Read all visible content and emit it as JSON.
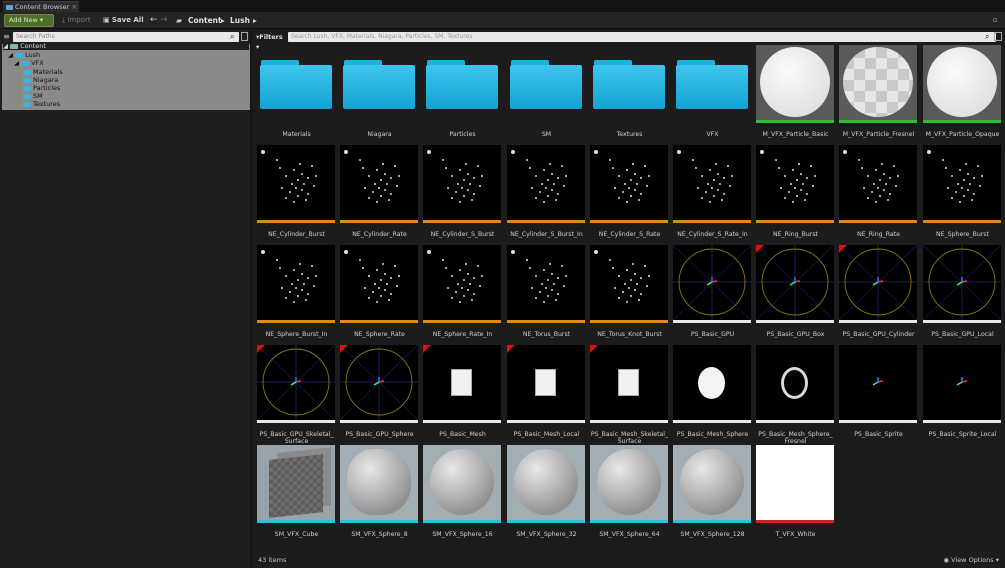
{
  "window": {
    "tab_title": "Content Browser",
    "tab_close": "×"
  },
  "toolbar": {
    "add_new": "Add New",
    "import": "Import",
    "save_all": "Save All",
    "crumbs": [
      "Content",
      "Lush"
    ]
  },
  "left": {
    "search_placeholder": "Search Paths",
    "tree": [
      "Content",
      "Lush",
      "VFX",
      "Materials",
      "Niagara",
      "Particles",
      "SM",
      "Textures"
    ]
  },
  "content": {
    "filters": "Filters",
    "search_placeholder": "Search Lush, VFX, Materials, Niagara, Particles, SM, Textures",
    "item_count": "43 items",
    "view_options": "View Options",
    "assets": [
      {
        "label": "Materials",
        "kind": "folder"
      },
      {
        "label": "Niagara",
        "kind": "folder"
      },
      {
        "label": "Particles",
        "kind": "folder"
      },
      {
        "label": "SM",
        "kind": "folder"
      },
      {
        "label": "Textures",
        "kind": "folder"
      },
      {
        "label": "VFX",
        "kind": "folder"
      },
      {
        "label": "M_VFX_Particle_Basic",
        "kind": "material"
      },
      {
        "label": "M_VFX_Particle_Fresnel",
        "kind": "material"
      },
      {
        "label": "M_VFX_Particle_Opaque",
        "kind": "material"
      },
      {
        "label": "NE_Cylinder_Burst",
        "kind": "niagara"
      },
      {
        "label": "NE_Cylinder_Rate",
        "kind": "niagara"
      },
      {
        "label": "NE_Cylinder_S_Burst",
        "kind": "niagara"
      },
      {
        "label": "NE_Cylinder_S_Burst_In",
        "kind": "niagara"
      },
      {
        "label": "NE_Cylinder_S_Rate",
        "kind": "niagara"
      },
      {
        "label": "NE_Cylinder_S_Rate_In",
        "kind": "niagara"
      },
      {
        "label": "NE_Ring_Burst",
        "kind": "niagara"
      },
      {
        "label": "NE_Ring_Rate",
        "kind": "niagara"
      },
      {
        "label": "NE_Sphere_Burst",
        "kind": "niagara"
      },
      {
        "label": "NE_Sphere_Burst_In",
        "kind": "niagara"
      },
      {
        "label": "NE_Sphere_Rate",
        "kind": "niagara"
      },
      {
        "label": "NE_Sphere_Rate_In",
        "kind": "niagara"
      },
      {
        "label": "NE_Torus_Burst",
        "kind": "niagara"
      },
      {
        "label": "NE_Torus_Knot_Burst",
        "kind": "niagara"
      },
      {
        "label": "PS_Basic_GPU",
        "kind": "ps_grid"
      },
      {
        "label": "PS_Basic_GPU_Box",
        "kind": "ps_grid",
        "red": true
      },
      {
        "label": "PS_Basic_GPU_Cylinder",
        "kind": "ps_grid",
        "red": true
      },
      {
        "label": "PS_Basic_GPU_Local",
        "kind": "ps_grid"
      },
      {
        "label": "PS_Basic_GPU_Skeletal_\nSurface",
        "kind": "ps_grid",
        "red": true
      },
      {
        "label": "PS_Basic_GPU_Sphere",
        "kind": "ps_grid",
        "red": true
      },
      {
        "label": "PS_Basic_Mesh",
        "kind": "ps_square",
        "red": true
      },
      {
        "label": "PS_Basic_Mesh_Local",
        "kind": "ps_square",
        "red": true
      },
      {
        "label": "PS_Basic_Mesh_Skeletal_\nSurface",
        "kind": "ps_square",
        "red": true
      },
      {
        "label": "PS_Basic_Mesh_Sphere",
        "kind": "ps_oval"
      },
      {
        "label": "PS_Basic_Mesh_Sphere_\nFresnel",
        "kind": "ps_ring"
      },
      {
        "label": "PS_Basic_Sprite",
        "kind": "ps_dot"
      },
      {
        "label": "PS_Basic_Sprite_Local",
        "kind": "ps_dot"
      },
      {
        "label": "SM_VFX_Cube",
        "kind": "mesh_cube"
      },
      {
        "label": "SM_VFX_Sphere_8",
        "kind": "mesh_sphere"
      },
      {
        "label": "SM_VFX_Sphere_16",
        "kind": "mesh_sphere"
      },
      {
        "label": "SM_VFX_Sphere_32",
        "kind": "mesh_sphere"
      },
      {
        "label": "SM_VFX_Sphere_64",
        "kind": "mesh_sphere"
      },
      {
        "label": "SM_VFX_Sphere_128",
        "kind": "mesh_sphere"
      },
      {
        "label": "T_VFX_White",
        "kind": "texture"
      }
    ]
  }
}
